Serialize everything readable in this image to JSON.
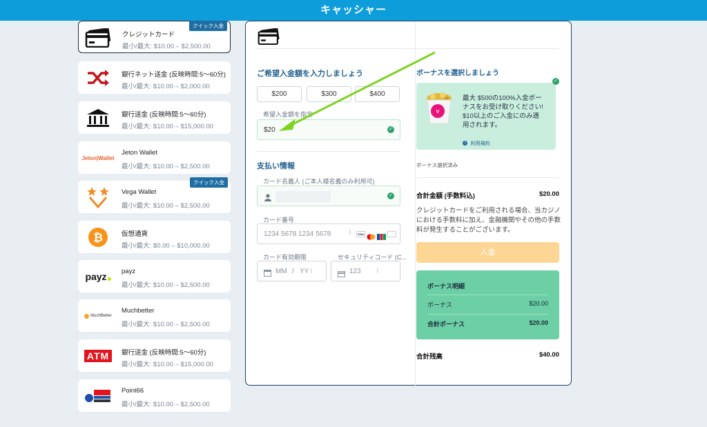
{
  "header": {
    "title": "キャッシャー"
  },
  "colors": {
    "accent": "#0d9ddb",
    "panel_border": "#1c3f67",
    "bonus_bg": "#c9eede",
    "summary_bg": "#6ccfa6",
    "deposit_btn": "#fdd696",
    "arrow": "#7ed321"
  },
  "methods": [
    {
      "name": "クレジットカード",
      "range": "最小/最大: $10.00 – $2,500.00",
      "badge": "クイック入金",
      "icon": "credit-card-icon"
    },
    {
      "name": "銀行ネット送金 (反映時間:5〜60分)",
      "range": "最小/最大: $10.00 – $2,000.00",
      "icon": "shuffle-icon"
    },
    {
      "name": "銀行送金 (反映時間:5〜60分)",
      "range": "最小/最大: $10.00 – $15,000.00",
      "icon": "bank-icon"
    },
    {
      "name": "Jeton Wallet",
      "range": "最小/最大: $10.00 – $2,500.00",
      "logo_text": "Jeton|Wallet",
      "icon": "jeton-logo"
    },
    {
      "name": "Vega Wallet",
      "range": "最小/最大: $10.00 – $2,500.00",
      "badge": "クイック入金",
      "icon": "vega-logo"
    },
    {
      "name": "仮想通貨",
      "range": "最小/最大: $0.00 – $10,000.00",
      "icon": "bitcoin-icon"
    },
    {
      "name": "payz",
      "range": "最小/最大: $10.00 – $2,500.00",
      "logo_text": "payz",
      "icon": "payz-logo"
    },
    {
      "name": "Muchbetter",
      "range": "最小/最大: $10.00 – $2,500.00",
      "logo_text": "MuchBetter",
      "icon": "muchbetter-logo"
    },
    {
      "name": "銀行送金 (反映時間:5〜60分)",
      "range": "最小/最大: $10.00 – $15,000.00",
      "logo_text": "ATM",
      "icon": "atm-logo"
    },
    {
      "name": "Point66",
      "range": "最小/最大: $10.00 – $2,500.00",
      "icon": "point66-logo"
    }
  ],
  "deposit": {
    "title": "ご希望入金額を入力しましょう",
    "amount_options": [
      "$200",
      "$300",
      "$400"
    ],
    "custom_label": "希望入金額を指定",
    "custom_value": "$20"
  },
  "payment": {
    "title": "支払い情報",
    "holder_label": "カード名義人 (ご本人様名義のみ利用可)",
    "number_label": "カード番号",
    "number_placeholder": "1234 5678 1234 5678",
    "expiry_label": "カード有効期限",
    "expiry_placeholder_mm": "MM",
    "expiry_sep": "/",
    "expiry_placeholder_yy": "YY",
    "cvc_label": "セキュリティコード (C...",
    "cvc_placeholder": "123",
    "card_brands": [
      "VISA",
      "MC",
      "JCB"
    ]
  },
  "bonus": {
    "title": "ボーナスを選択しましょう",
    "card_text_line1": "最大 $500の100%入金ボー",
    "card_text_line2": "ナスをお受け取りください!",
    "card_text_line3": "$10以上のご入金にのみ適",
    "card_text_line4": "用されます。",
    "terms_link": "利用規約",
    "selected_note": "ボーナス選択済み"
  },
  "totals": {
    "total_label": "合計金額 (手数料込)",
    "total_value": "$20.00",
    "fee_note_line1": "クレジットカードをご利用される場合、当カジノ",
    "fee_note_line2": "における手数料に加え、金融機関やその他の手数",
    "fee_note_line3": "料が発生することがございます。",
    "deposit_button": "入金",
    "summary_title": "ボーナス明細",
    "bonus_label": "ボーナス",
    "bonus_value": "$20.00",
    "total_bonus_label": "合計ボーナス",
    "total_bonus_value": "$20.00",
    "balance_label": "合計残高",
    "balance_value": "$40.00"
  }
}
